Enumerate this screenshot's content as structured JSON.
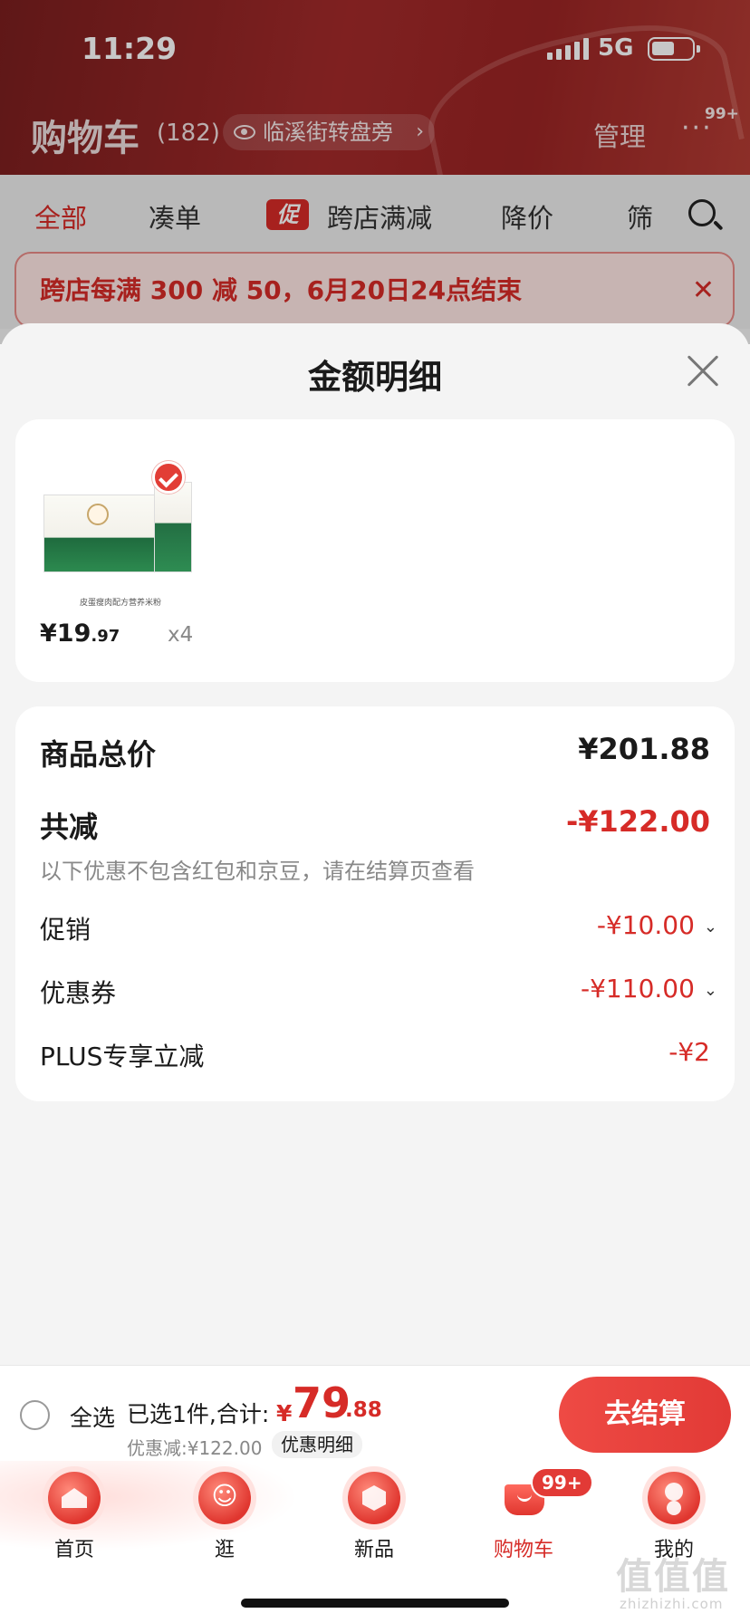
{
  "status_bar": {
    "time": "11:29",
    "network": "5G"
  },
  "header": {
    "title": "购物车",
    "count": "(182)",
    "address": "临溪街转盘旁",
    "manage": "管理",
    "more": "···",
    "more_badge": "99+"
  },
  "tabs": [
    {
      "label": "全部"
    },
    {
      "label": "凑单"
    },
    {
      "label": "跨店满减",
      "badge": "促"
    },
    {
      "label": "降价"
    },
    {
      "label": "筛"
    }
  ],
  "banner": {
    "text": "跨店每满 300 减 50，6月20日24点结束",
    "close": "✕"
  },
  "sheet": {
    "title": "金额明细",
    "product": {
      "caption": "皮蛋瘦肉配方营养米粉",
      "price_main": "¥19",
      "price_decimal": ".97",
      "quantity": "x4"
    },
    "summary": {
      "total_label": "商品总价",
      "total_value": "¥201.88",
      "reduced_label": "共减",
      "reduced_value": "-¥122.00",
      "note": "以下优惠不包含红包和京豆，请在结算页查看",
      "items": [
        {
          "label": "促销",
          "value": "-¥10.00"
        },
        {
          "label": "优惠券",
          "value": "-¥110.00"
        },
        {
          "label": "PLUS专享立减",
          "value": "-¥2"
        }
      ]
    }
  },
  "checkout": {
    "select_all": "全选",
    "selected_text": "已选1件,合计:",
    "currency": "¥",
    "total_main": "79",
    "total_decimal": ".88",
    "discount_line": "优惠减:¥122.00",
    "detail_chip": "优惠明细",
    "pay_button": "去结算"
  },
  "tabbar": {
    "items": [
      {
        "label": "首页",
        "icon": "home-icon"
      },
      {
        "label": "逛",
        "icon": "stroll-icon"
      },
      {
        "label": "新品",
        "icon": "new-products-icon"
      },
      {
        "label": "购物车",
        "icon": "cart-icon"
      },
      {
        "label": "我的",
        "icon": "profile-icon"
      }
    ],
    "cart_badge": "99+"
  },
  "watermark": {
    "main": "值值值",
    "sub": "zhizhizhi.com"
  }
}
